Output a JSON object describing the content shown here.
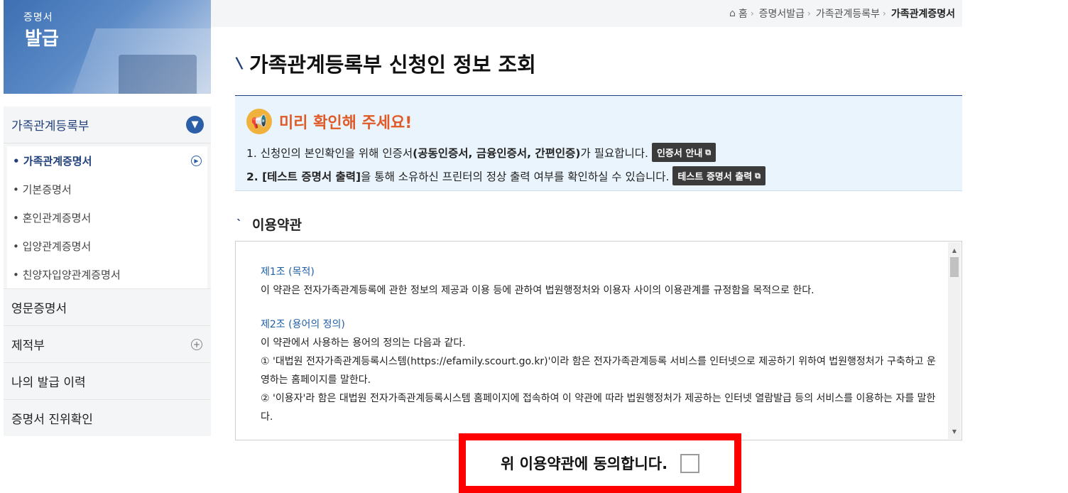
{
  "banner": {
    "line1": "증명서",
    "line2": "발급"
  },
  "sidebar": {
    "section": "가족관계등록부",
    "sub_items": [
      {
        "label": "• 가족관계증명서",
        "active": true
      },
      {
        "label": "• 기본증명서"
      },
      {
        "label": "• 혼인관계증명서"
      },
      {
        "label": "• 입양관계증명서"
      },
      {
        "label": "• 친양자입양관계증명서"
      }
    ],
    "rows": [
      {
        "label": "영문증명서"
      },
      {
        "label": "제적부"
      },
      {
        "label": "나의 발급 이력"
      },
      {
        "label": "증명서 진위확인"
      }
    ]
  },
  "breadcrumb": {
    "home": "홈",
    "items": [
      "증명서발급",
      "가족관계등록부"
    ],
    "current": "가족관계증명서"
  },
  "page_title": "가족관계등록부 신청인 정보 조회",
  "notice": {
    "heading": "미리 확인해 주세요!",
    "line1_pre": "1. 신청인의 본인확인을 위해 인증서",
    "line1_bold": "(공동인증서, 금융인증서, 간편인증)",
    "line1_post": "가 필요합니다.",
    "line1_button": "인증서 안내",
    "line2_bold": "2. [테스트 증명서 출력]",
    "line2_post": "을 통해 소유하신 프린터의 정상 출력 여부를 확인하실 수 있습니다.",
    "line2_button": "테스트 증명서 출력"
  },
  "terms": {
    "title": "이용약관",
    "article1_title": "제1조 (목적)",
    "article1_body": "이 약관은 전자가족관계등록에 관한 정보의 제공과 이용 등에 관하여 법원행정처와 이용자 사이의 이용관계를 규정함을 목적으로 한다.",
    "article2_title": "제2조 (용어의 정의)",
    "article2_intro": "이 약관에서 사용하는 용어의 정의는 다음과 같다.",
    "article2_item1": "① '대법원 전자가족관계등록시스템(https://efamily.scourt.go.kr)'이라 함은 전자가족관계등록 서비스를 인터넷으로 제공하기 위하여 법원행정처가 구축하고 운영하는 홈페이지를 말한다.",
    "article2_item2": "② '이용자'라 함은 대법원 전자가족관계등록시스템 홈페이지에 접속하여 이 약관에 따라 법원행정처가 제공하는 인터넷 열람발급 등의 서비스를 이용하는 자를 말한다."
  },
  "agree": {
    "label": "위 이용약관에 동의합니다.",
    "checked": false
  },
  "colors": {
    "accent": "#1f3f7a",
    "notice_heading": "#e05a28",
    "highlight_border": "#ff0000"
  }
}
